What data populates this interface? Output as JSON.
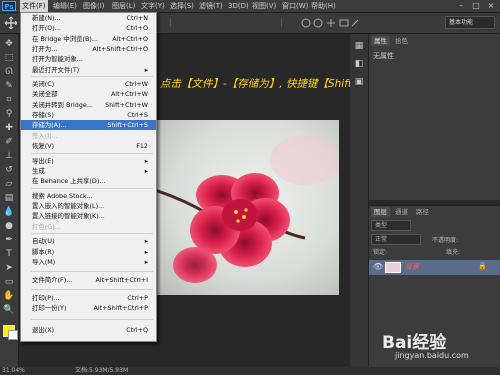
{
  "menubar": {
    "logo": "Ps",
    "items": [
      "文件(F)",
      "编辑(E)",
      "图像(I)",
      "图层(L)",
      "文字(Y)",
      "选择(S)",
      "滤镜(T)",
      "3D(D)",
      "视图(V)",
      "窗口(W)",
      "帮助(H)"
    ]
  },
  "optbar": {
    "workspace": "基本功能"
  },
  "file_menu": {
    "items": [
      {
        "label": "新建(N)...",
        "shortcut": "Ctrl+N"
      },
      {
        "label": "打开(O)...",
        "shortcut": "Ctrl+O"
      },
      {
        "label": "在 Bridge 中浏览(B)...",
        "shortcut": "Alt+Ctrl+O"
      },
      {
        "label": "打开为...",
        "shortcut": "Alt+Shift+Ctrl+O"
      },
      {
        "label": "打开为智能对象...",
        "shortcut": ""
      },
      {
        "label": "最近打开文件(T)",
        "shortcut": "▸"
      },
      {
        "label": "关闭(C)",
        "shortcut": "Ctrl+W"
      },
      {
        "label": "关闭全部",
        "shortcut": "Alt+Ctrl+W"
      },
      {
        "label": "关闭并转到 Bridge...",
        "shortcut": "Shift+Ctrl+W"
      },
      {
        "label": "存储(S)",
        "shortcut": "Ctrl+S"
      },
      {
        "label": "存储为(A)...",
        "shortcut": "Shift+Ctrl+S"
      },
      {
        "label": "签入(I)...",
        "shortcut": ""
      },
      {
        "label": "恢复(V)",
        "shortcut": "F12"
      },
      {
        "label": "导出(E)",
        "shortcut": "▸"
      },
      {
        "label": "生成",
        "shortcut": "▸"
      },
      {
        "label": "在 Behance 上共享(D)...",
        "shortcut": ""
      },
      {
        "label": "搜索 Adobe Stock...",
        "shortcut": ""
      },
      {
        "label": "置入嵌入的智能对象(L)...",
        "shortcut": ""
      },
      {
        "label": "置入链接的智能对象(K)...",
        "shortcut": ""
      },
      {
        "label": "打包(G)...",
        "shortcut": ""
      },
      {
        "label": "自动(U)",
        "shortcut": "▸"
      },
      {
        "label": "脚本(R)",
        "shortcut": "▸"
      },
      {
        "label": "导入(M)",
        "shortcut": "▸"
      },
      {
        "label": "文件简介(F)...",
        "shortcut": "Alt+Shift+Ctrl+I"
      },
      {
        "label": "打印(P)...",
        "shortcut": "Ctrl+P"
      },
      {
        "label": "打印一份(Y)",
        "shortcut": "Alt+Shift+Ctrl+P"
      },
      {
        "label": "退出(X)",
        "shortcut": "Ctrl+Q"
      }
    ]
  },
  "annotation": "点击【文件】-【存储为】, 快捷键【Shift+Ctrl+S】",
  "properties_panel": {
    "tabs": [
      "属性",
      "拾色"
    ],
    "empty_text": "无属性"
  },
  "layers_panel": {
    "tabs": [
      "图层",
      "通道",
      "路径"
    ],
    "filter": "类型",
    "blend_mode": "正常",
    "opacity_label": "不透明度:",
    "lock_label": "锁定:",
    "fill_label": "填充:",
    "layer_name": "背景"
  },
  "status": {
    "zoom": "31.04%",
    "doc": "文档:5.93M/5.93M"
  },
  "watermark": {
    "brand": "Bai经验",
    "url": "jingyan.baidu.com"
  },
  "colors": {
    "accent": "#3a74c6",
    "annotation": "#ffd700",
    "foreground": "#ffef00",
    "background": "#ffffff"
  }
}
